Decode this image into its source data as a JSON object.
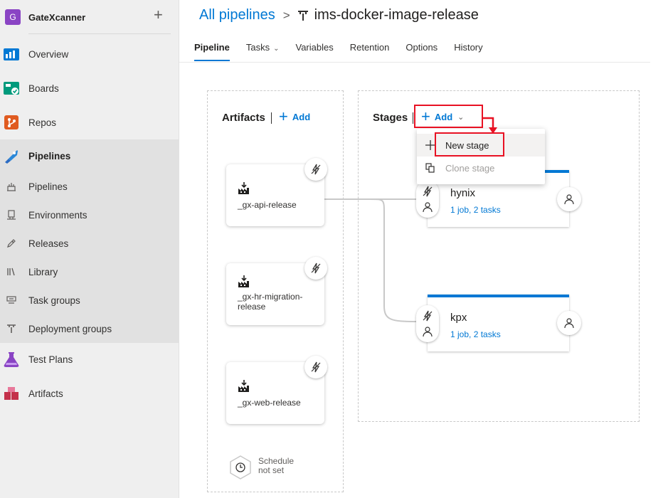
{
  "org": {
    "initial": "G",
    "name": "GateXcanner",
    "add_icon": "plus-icon"
  },
  "sidebar": {
    "items": [
      {
        "label": "Overview",
        "icon": "overview-icon"
      },
      {
        "label": "Boards",
        "icon": "boards-icon"
      },
      {
        "label": "Repos",
        "icon": "repos-icon"
      },
      {
        "label": "Pipelines",
        "icon": "pipelines-icon"
      },
      {
        "label": "Pipelines",
        "icon": "pipeline-sub-icon"
      },
      {
        "label": "Environments",
        "icon": "environments-icon"
      },
      {
        "label": "Releases",
        "icon": "releases-icon"
      },
      {
        "label": "Library",
        "icon": "library-icon"
      },
      {
        "label": "Task groups",
        "icon": "task-groups-icon"
      },
      {
        "label": "Deployment groups",
        "icon": "deployment-groups-icon"
      },
      {
        "label": "Test Plans",
        "icon": "test-plans-icon"
      },
      {
        "label": "Artifacts",
        "icon": "artifacts-icon"
      }
    ]
  },
  "breadcrumb": {
    "root": "All pipelines",
    "separator": ">",
    "title": "ims-docker-image-release"
  },
  "tabs": [
    {
      "label": "Pipeline",
      "active": true
    },
    {
      "label": "Tasks",
      "active": false
    },
    {
      "label": "Variables",
      "active": false
    },
    {
      "label": "Retention",
      "active": false
    },
    {
      "label": "Options",
      "active": false
    },
    {
      "label": "History",
      "active": false
    }
  ],
  "artifacts": {
    "title": "Artifacts",
    "add_label": "Add",
    "items": [
      {
        "name": "_gx-api-release"
      },
      {
        "name": "_gx-hr-migration-release"
      },
      {
        "name": "_gx-web-release"
      }
    ],
    "schedule": {
      "line1": "Schedule",
      "line2": "not set"
    }
  },
  "stages": {
    "title": "Stages",
    "add_label": "Add",
    "menu": [
      {
        "label": "New stage",
        "icon": "plus-icon",
        "enabled": true
      },
      {
        "label": "Clone stage",
        "icon": "clone-icon",
        "enabled": false
      }
    ],
    "items": [
      {
        "name": "hynix",
        "summary": "1 job, 2 tasks"
      },
      {
        "name": "kpx",
        "summary": "1 job, 2 tasks"
      }
    ]
  },
  "colors": {
    "accent": "#0078d4",
    "highlight": "#e81123",
    "org_avatar": "#8a44c4"
  }
}
